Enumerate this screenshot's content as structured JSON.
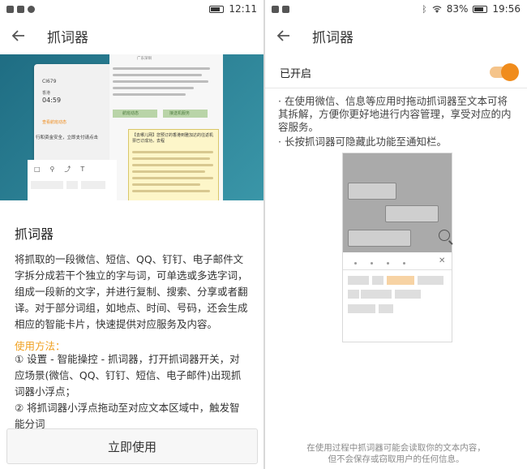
{
  "left": {
    "status": {
      "time": "12:11"
    },
    "appbar": {
      "title": "抓词器"
    },
    "preview": {
      "flight": "CI679",
      "city": "香港",
      "dep_time": "04:59",
      "left_link": "查看航班动态",
      "notice": "行和资金安全，立即支付请点击",
      "btn_left": "航班动态",
      "btn_right": "接送机服务",
      "sms_header": "广东深圳",
      "sms_text": "【去哪儿网】您预订的香港到雅加达的往返机票已订成功，去程"
    },
    "sheet": {
      "title": "抓词器",
      "description": "将抓取的一段微信、短信、QQ、钉钉、电子邮件文字拆分成若干个独立的字与词，可单选或多选字词，组成一段新的文字，并进行复制、搜索、分享或者翻译。对于部分词组，如地点、时间、号码，还会生成相应的智能卡片，快速提供对应服务及内容。",
      "usage_title": "使用方法：",
      "usage_1": "① 设置 - 智能操控 - 抓词器，打开抓词器开关，对应场景(微信、QQ、钉钉、短信、电子邮件)出现抓词器小浮点；",
      "usage_2": "② 将抓词器小浮点拖动至对应文本区域中，触发智能分词",
      "button": "立即使用"
    }
  },
  "right": {
    "status": {
      "battery": "83%",
      "time": "19:56"
    },
    "appbar": {
      "title": "抓词器"
    },
    "toggle": {
      "label": "已开启",
      "on": true
    },
    "desc_1": "· 在使用微信、信息等应用时拖动抓词器至文本可将其拆解，方便你更好地进行内容管理，享受对应的内容服务。",
    "desc_2": "· 长按抓词器可隐藏此功能至通知栏。",
    "footer_1": "在使用过程中抓词器可能会读取你的文本内容，",
    "footer_2": "但不会保存或窃取用户的任何信息。"
  },
  "colors": {
    "accent": "#f08c1c",
    "usage": "#f0a020"
  },
  "icons": [
    "back-arrow-icon",
    "battery-icon",
    "wifi-icon",
    "bluetooth-icon",
    "magnifier-icon",
    "close-icon"
  ]
}
